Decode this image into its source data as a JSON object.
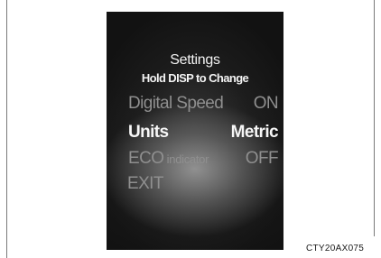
{
  "display": {
    "title": "Settings",
    "subtitle": "Hold DISP to Change",
    "menu": [
      {
        "label": "Digital Speed",
        "value": "ON"
      },
      {
        "label": "Units",
        "value": "Metric"
      },
      {
        "label_main": "ECO",
        "label_small": " indicator",
        "value": "OFF"
      },
      {
        "label": "EXIT"
      }
    ]
  },
  "figure_code": "CTY20AX075"
}
